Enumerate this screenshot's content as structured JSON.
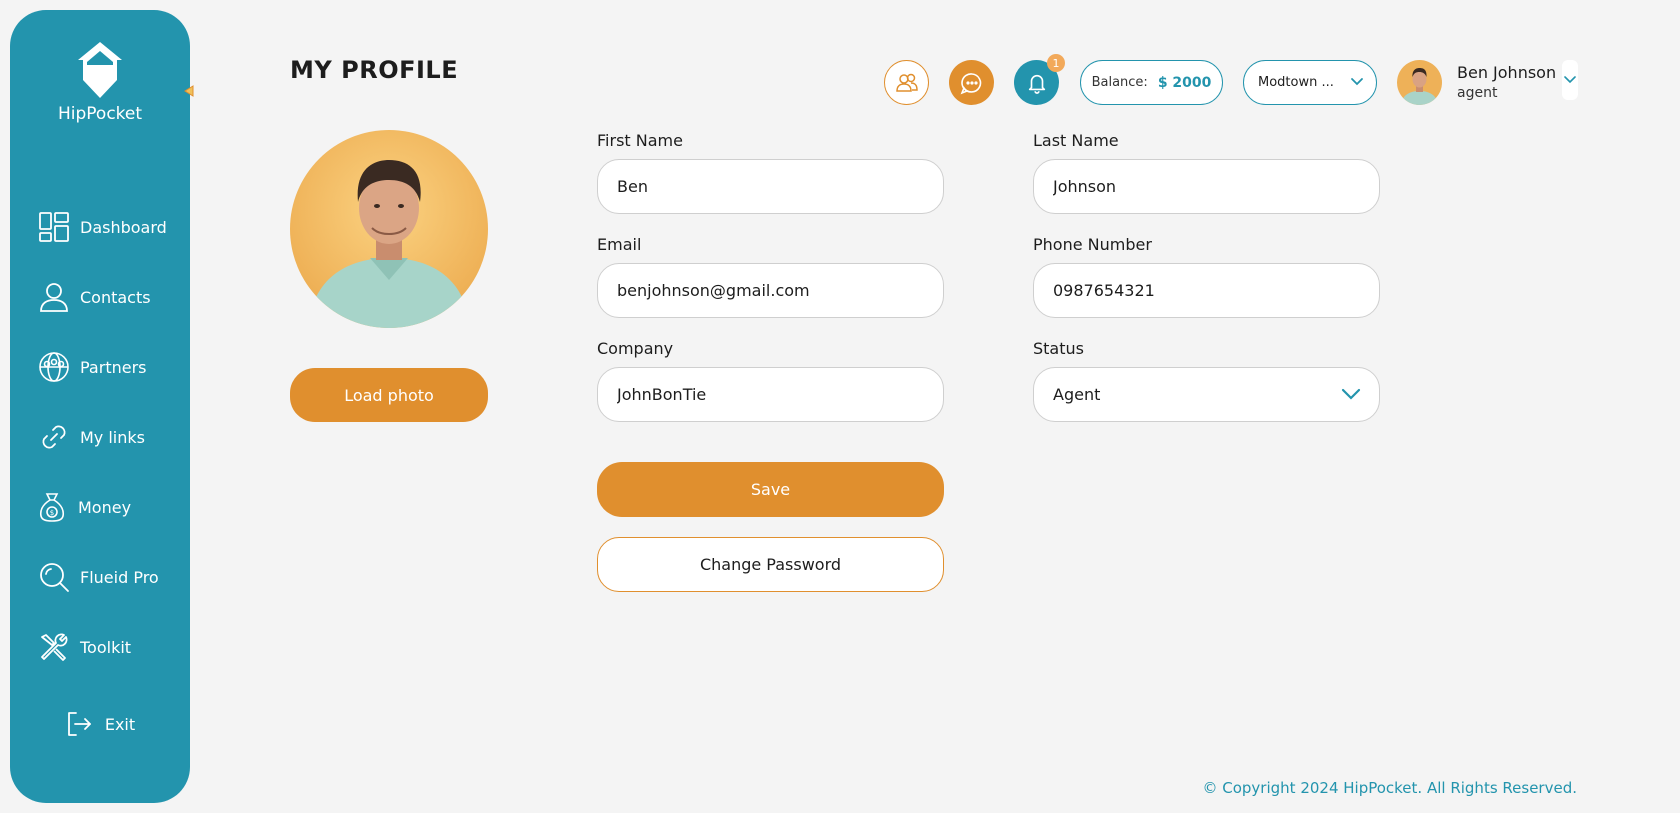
{
  "brand": {
    "name": "HipPocket"
  },
  "sidebar": {
    "items": [
      {
        "label": "Dashboard",
        "icon": "dashboard-icon"
      },
      {
        "label": "Contacts",
        "icon": "person-icon"
      },
      {
        "label": "Partners",
        "icon": "globe-people-icon"
      },
      {
        "label": "My links",
        "icon": "link-icon"
      },
      {
        "label": "Money",
        "icon": "money-bag-icon"
      },
      {
        "label": "Flueid Pro",
        "icon": "search-icon"
      },
      {
        "label": "Toolkit",
        "icon": "tools-icon"
      }
    ],
    "exit_label": "Exit"
  },
  "header": {
    "title": "MY PROFILE",
    "notification_count": "1",
    "balance_label": "Balance:",
    "balance_value": "$ 2000",
    "location": "Modtown ...",
    "user_name": "Ben Johnson",
    "user_role": "agent"
  },
  "profile": {
    "load_photo_label": "Load photo",
    "first_name_label": "First Name",
    "first_name": "Ben",
    "last_name_label": "Last Name",
    "last_name": "Johnson",
    "email_label": "Email",
    "email": "benjohnson@gmail.com",
    "phone_label": "Phone Number",
    "phone": "0987654321",
    "company_label": "Company",
    "company": "JohnBonTie",
    "status_label": "Status",
    "status": "Agent",
    "save_label": "Save",
    "change_password_label": "Change Password"
  },
  "footer": {
    "copyright": "© Copyright 2024 HipPocket. All Rights Reserved."
  },
  "colors": {
    "primary": "#2394ad",
    "accent": "#e08f2e",
    "background": "#f4f4f4"
  }
}
